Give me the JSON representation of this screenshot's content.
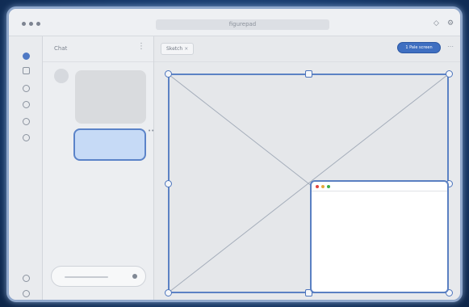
{
  "window": {
    "title": "",
    "url_text": "figurepad"
  },
  "titlebar_icons": [
    "shield-icon",
    "puzzle-icon"
  ],
  "rail": {
    "items": [
      "home-icon",
      "chat-icon",
      "stack-icon",
      "cloud-icon",
      "link-icon",
      "bell-icon"
    ],
    "bottom_items": [
      "settings-icon",
      "user-icon"
    ],
    "active_index": 0
  },
  "chat_panel": {
    "title": "Chat",
    "menu_glyph": "⋮",
    "time_glyph": "••",
    "composer_placeholder": ""
  },
  "main": {
    "tab_label": "Sketch",
    "tab_close": "×",
    "action_pill": "1 Pale screen",
    "head_menu": "⋯"
  },
  "colors": {
    "accent": "#4f79c4",
    "background": "#173a6c",
    "pip_red": "#e0443e",
    "pip_yellow": "#e5a93a",
    "pip_green": "#3fae4a"
  }
}
